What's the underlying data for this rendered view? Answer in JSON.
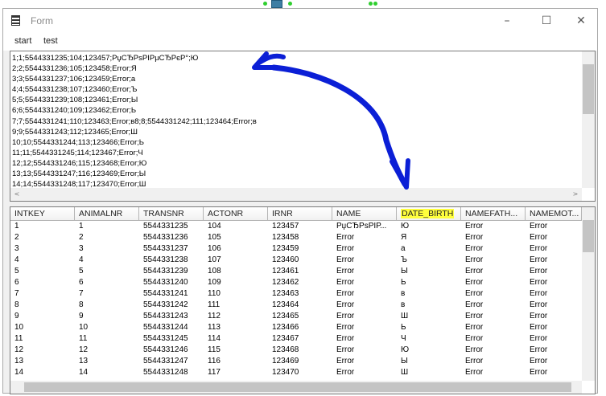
{
  "window": {
    "title": "Form",
    "controls": [
      "–",
      "☐",
      "✕"
    ]
  },
  "menu": [
    "start",
    "test"
  ],
  "memo": {
    "lines": [
      "1;1;5544331235;104;123457;РџСЂРѕРІРµСЂРєР°;Ю",
      "2;2;5544331236;105;123458;Error;Я",
      "3;3;5544331237;106;123459;Error;а",
      "4;4;5544331238;107;123460;Error;Ъ",
      "5;5;5544331239;108;123461;Error;Ы",
      "6;6;5544331240;109;123462;Error;Ь",
      "7;7;5544331241;110;123463;Error;в8;8;5544331242;111;123464;Error;в",
      "9;9;5544331243;112;123465;Error;Ш",
      "10;10;5544331244;113;123466;Error;Ь",
      "11;11;5544331245;114;123467;Error;Ч",
      "12;12;5544331246;115;123468;Error;Ю",
      "13;13;5544331247;116;123469;Error;Ы",
      "14;14;5544331248;117;123470;Error;Ш"
    ]
  },
  "grid": {
    "columns": [
      "INTKEY",
      "ANIMALNR",
      "TRANSNR",
      "ACTONR",
      "IRNR",
      "NAME",
      "DATE_BIRTH",
      "NAMEFATH...",
      "NAMEMOT..."
    ],
    "highlight_column": "DATE_BIRTH",
    "highlight_color": "#ffff3c",
    "rows": [
      [
        "1",
        "1",
        "5544331235",
        "104",
        "123457",
        "РџСЂРѕРІР...",
        "Ю",
        "Error",
        "Error"
      ],
      [
        "2",
        "2",
        "5544331236",
        "105",
        "123458",
        "Error",
        "Я",
        "Error",
        "Error"
      ],
      [
        "3",
        "3",
        "5544331237",
        "106",
        "123459",
        "Error",
        "а",
        "Error",
        "Error"
      ],
      [
        "4",
        "4",
        "5544331238",
        "107",
        "123460",
        "Error",
        "Ъ",
        "Error",
        "Error"
      ],
      [
        "5",
        "5",
        "5544331239",
        "108",
        "123461",
        "Error",
        "Ы",
        "Error",
        "Error"
      ],
      [
        "6",
        "6",
        "5544331240",
        "109",
        "123462",
        "Error",
        "Ь",
        "Error",
        "Error"
      ],
      [
        "7",
        "7",
        "5544331241",
        "110",
        "123463",
        "Error",
        "в",
        "Error",
        "Error"
      ],
      [
        "8",
        "8",
        "5544331242",
        "111",
        "123464",
        "Error",
        "в",
        "Error",
        "Error"
      ],
      [
        "9",
        "9",
        "5544331243",
        "112",
        "123465",
        "Error",
        "Ш",
        "Error",
        "Error"
      ],
      [
        "10",
        "10",
        "5544331244",
        "113",
        "123466",
        "Error",
        "Ь",
        "Error",
        "Error"
      ],
      [
        "11",
        "11",
        "5544331245",
        "114",
        "123467",
        "Error",
        "Ч",
        "Error",
        "Error"
      ],
      [
        "12",
        "12",
        "5544331246",
        "115",
        "123468",
        "Error",
        "Ю",
        "Error",
        "Error"
      ],
      [
        "13",
        "13",
        "5544331247",
        "116",
        "123469",
        "Error",
        "Ы",
        "Error",
        "Error"
      ],
      [
        "14",
        "14",
        "5544331248",
        "117",
        "123470",
        "Error",
        "Ш",
        "Error",
        "Error"
      ]
    ]
  },
  "annotation": {
    "color": "#0b1fd6"
  }
}
